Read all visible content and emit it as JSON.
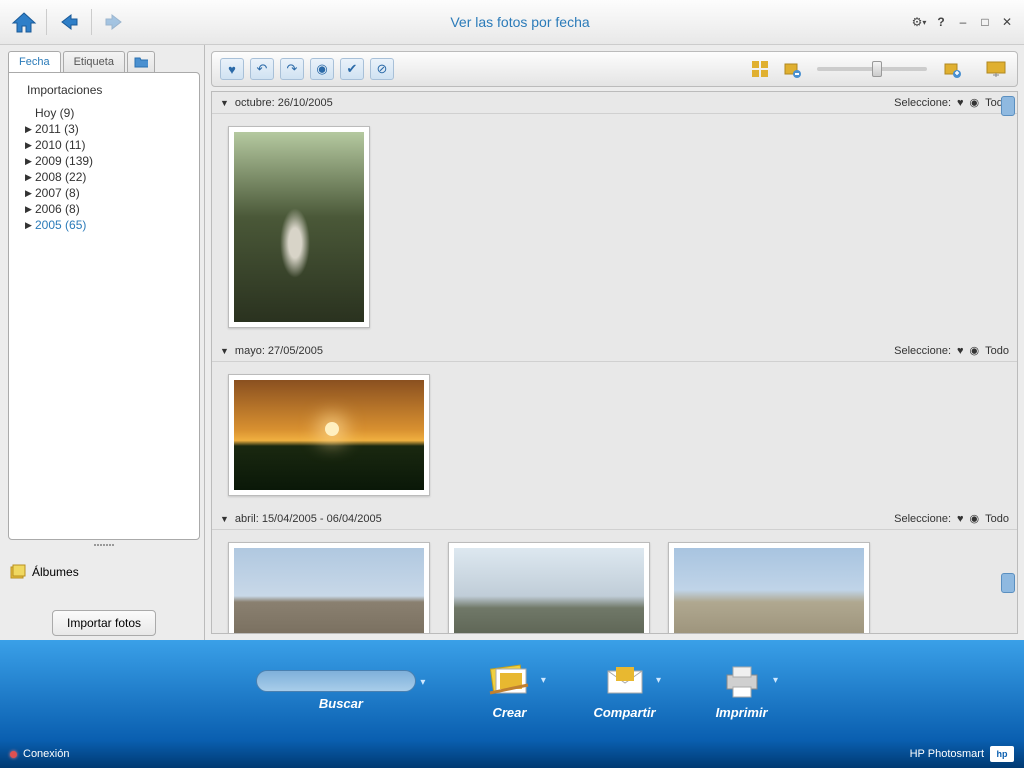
{
  "title": "Ver las fotos por fecha",
  "sidebar": {
    "tabs": {
      "date": "Fecha",
      "tag": "Etiqueta"
    },
    "header": "Importaciones",
    "items": [
      {
        "label": "Hoy (9)",
        "expandable": false,
        "active": false
      },
      {
        "label": "2011 (3)",
        "expandable": true,
        "active": false
      },
      {
        "label": "2010 (11)",
        "expandable": true,
        "active": false
      },
      {
        "label": "2009 (139)",
        "expandable": true,
        "active": false
      },
      {
        "label": "2008 (22)",
        "expandable": true,
        "active": false
      },
      {
        "label": "2007 (8)",
        "expandable": true,
        "active": false
      },
      {
        "label": "2006 (8)",
        "expandable": true,
        "active": false
      },
      {
        "label": "2005 (65)",
        "expandable": true,
        "active": true
      }
    ],
    "albums_label": "Álbumes",
    "import_button": "Importar fotos"
  },
  "groups": [
    {
      "title": "octubre: 26/10/2005",
      "select_label": "Seleccione:",
      "all_label": "Todo"
    },
    {
      "title": "mayo: 27/05/2005",
      "select_label": "Seleccione:",
      "all_label": "Todo"
    },
    {
      "title": "abril: 15/04/2005 - 06/04/2005",
      "select_label": "Seleccione:",
      "all_label": "Todo"
    }
  ],
  "bottom": {
    "search": "Buscar",
    "create": "Crear",
    "share": "Compartir",
    "print": "Imprimir"
  },
  "status": {
    "connection": "Conexión",
    "brand": "HP Photosmart"
  }
}
